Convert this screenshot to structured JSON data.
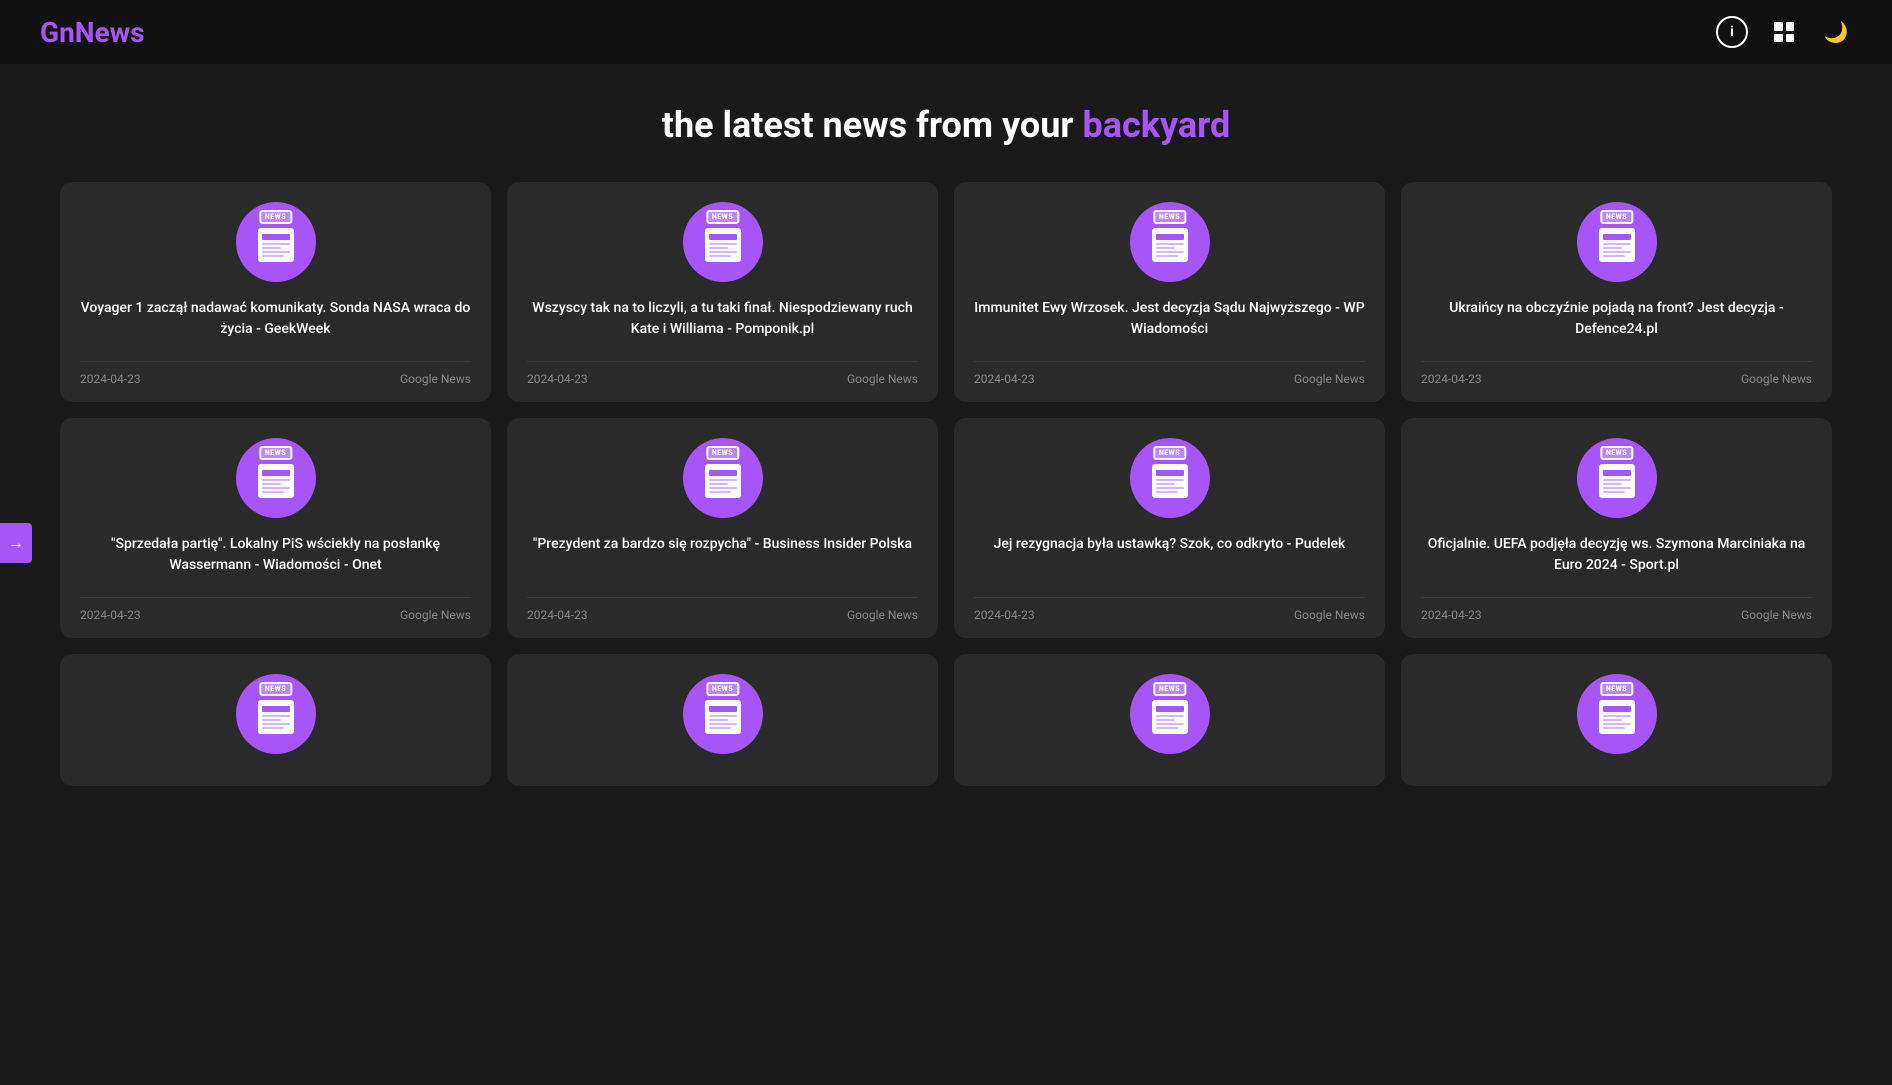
{
  "header": {
    "logo": "GnNews",
    "icons": {
      "info": "i",
      "grid": "grid",
      "moon": "🌙"
    }
  },
  "sidebar": {
    "toggle_icon": "→"
  },
  "hero": {
    "text_plain": "the latest news from your ",
    "text_accent": "backyard"
  },
  "cards": [
    {
      "title": "Voyager 1 zaczął nadawać komunikaty. Sonda NASA wraca do życia - GeekWeek",
      "date": "2024-04-23",
      "source": "Google News"
    },
    {
      "title": "Wszyscy tak na to liczyli, a tu taki finał. Niespodziewany ruch Kate i Williama - Pomponik.pl",
      "date": "2024-04-23",
      "source": "Google News"
    },
    {
      "title": "Immunitet Ewy Wrzosek. Jest decyzja Sądu Najwyższego - WP Wiadomości",
      "date": "2024-04-23",
      "source": "Google News"
    },
    {
      "title": "Ukraińcy na obczyźnie pojadą na front? Jest decyzja - Defence24.pl",
      "date": "2024-04-23",
      "source": "Google News"
    },
    {
      "title": "\"Sprzedała partię\". Lokalny PiS wściekły na posłankę Wassermann - Wiadomości - Onet",
      "date": "2024-04-23",
      "source": "Google News"
    },
    {
      "title": "\"Prezydent za bardzo się rozpycha\" - Business Insider Polska",
      "date": "2024-04-23",
      "source": "Google News"
    },
    {
      "title": "Jej rezygnacja była ustawką? Szok, co odkryto - Pudelek",
      "date": "2024-04-23",
      "source": "Google News"
    },
    {
      "title": "Oficjalnie. UEFA podjęła decyzję ws. Szymona Marciniaka na Euro 2024 - Sport.pl",
      "date": "2024-04-23",
      "source": "Google News"
    },
    {
      "title": "",
      "date": "",
      "source": "",
      "partial": true
    },
    {
      "title": "",
      "date": "",
      "source": "",
      "partial": true
    },
    {
      "title": "",
      "date": "",
      "source": "",
      "partial": true
    },
    {
      "title": "",
      "date": "",
      "source": "",
      "partial": true
    }
  ]
}
